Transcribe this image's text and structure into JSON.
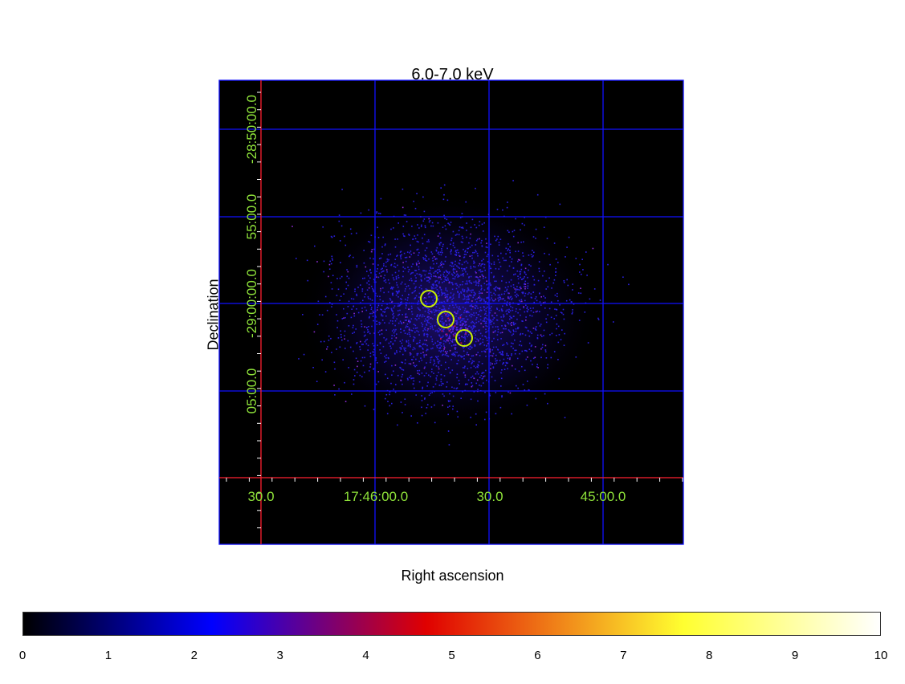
{
  "title": "6.0-7.0 keV",
  "xlabel": "Right ascension",
  "ylabel": "Declination",
  "ra_ticks": [
    "30.0",
    "17:46:00.0",
    "30.0",
    "45:00.0"
  ],
  "dec_ticks": [
    "-28:50:00.0",
    "55:00.0",
    "-29:00:00.0",
    "05:00.0"
  ],
  "regions": [
    {
      "shape": "circle",
      "color": "#c8f000"
    },
    {
      "shape": "circle",
      "color": "#c8f000"
    },
    {
      "shape": "circle",
      "color": "#c8f000"
    }
  ],
  "colors": {
    "grid": "#1010ff",
    "axis": "#ff2030",
    "labels": "#8fe33a",
    "background": "#000000"
  },
  "colorbar": {
    "min": 0,
    "max": 10,
    "tick_labels": [
      "0",
      "1",
      "2",
      "3",
      "4",
      "5",
      "6",
      "7",
      "8",
      "9",
      "10"
    ],
    "gradient": [
      "#000000",
      "#0000ff",
      "#e00000",
      "#ffff30",
      "#ffffff"
    ]
  }
}
